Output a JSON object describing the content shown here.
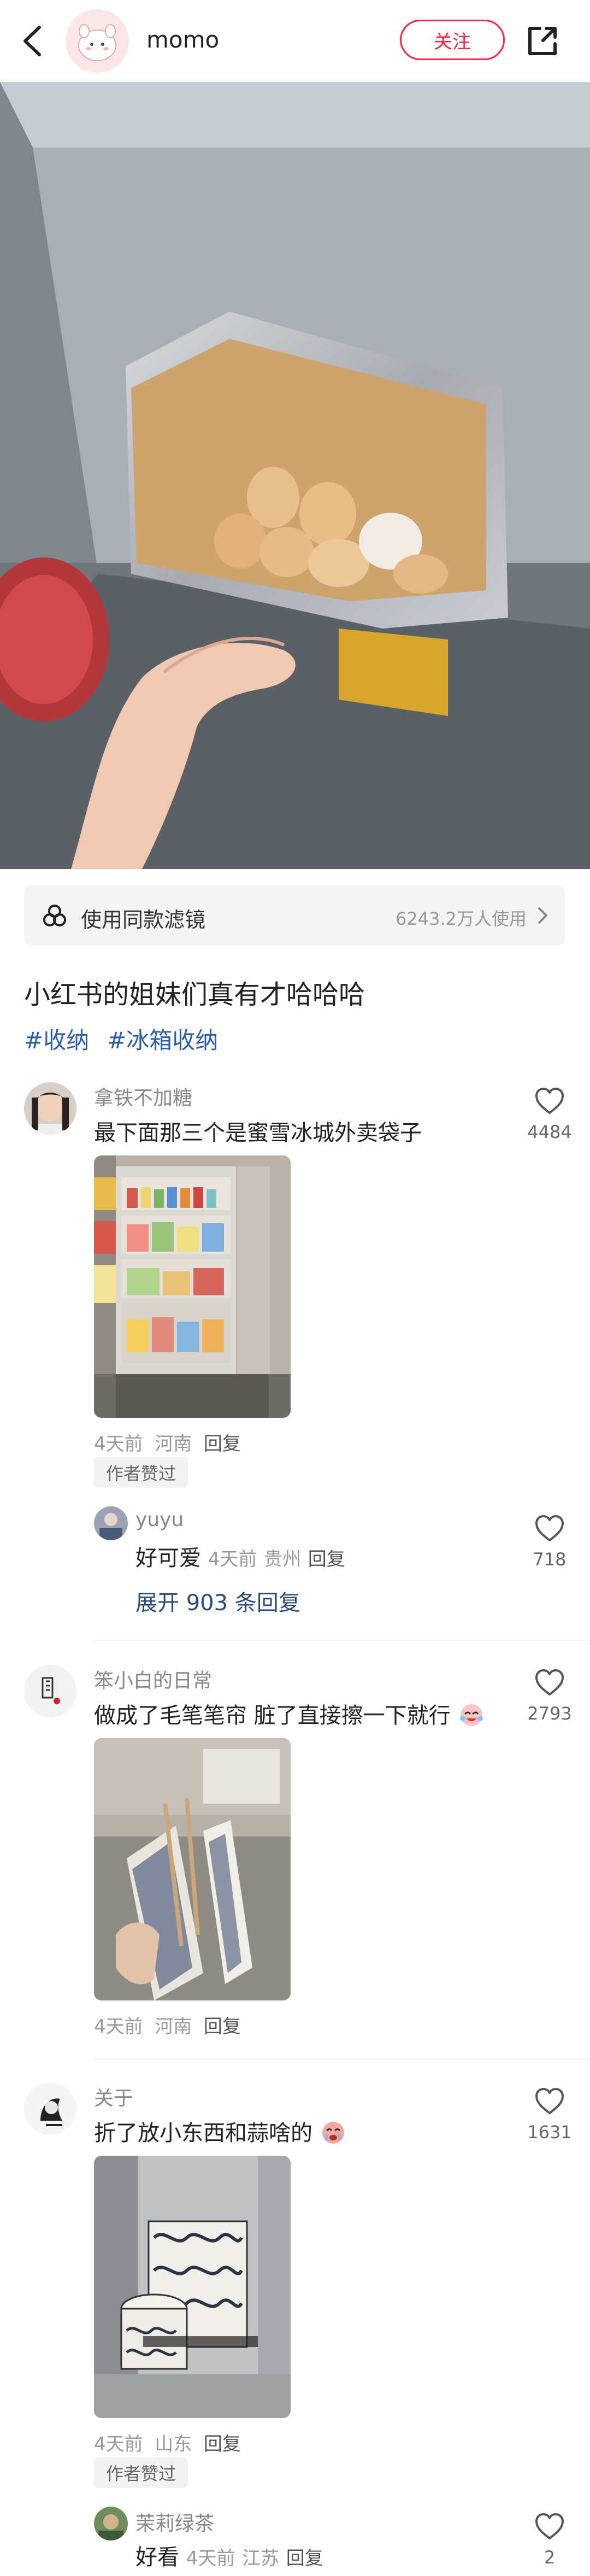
{
  "header": {
    "author": "momo",
    "follow_label": "关注"
  },
  "filter": {
    "label": "使用同款滤镜",
    "count": "6243.2万人使用"
  },
  "post": {
    "title": "小红书的姐妹们真有才哈哈哈",
    "tags": [
      "#收纳",
      "#冰箱收纳"
    ]
  },
  "comments": [
    {
      "name": "拿铁不加糖",
      "text": "最下面那三个是蜜雪冰城外卖袋子",
      "time": "4天前",
      "location": "河南",
      "reply_label": "回复",
      "likes": "4484",
      "badge": "作者赞过",
      "replies": [
        {
          "name": "yuyu",
          "text": "好可爱",
          "time": "4天前",
          "location": "贵州",
          "reply_label": "回复",
          "likes": "718"
        }
      ],
      "expand_label": "展开 903 条回复"
    },
    {
      "name": "笨小白的日常",
      "text": "做成了毛笔笔帘 脏了直接擦一下就行",
      "time": "4天前",
      "location": "河南",
      "reply_label": "回复",
      "likes": "2793"
    },
    {
      "name": "关于",
      "text": "折了放小东西和蒜啥的",
      "time": "4天前",
      "location": "山东",
      "reply_label": "回复",
      "likes": "1631",
      "badge": "作者赞过",
      "replies": [
        {
          "name": "茉莉绿茶",
          "text": "好看",
          "time": "4天前",
          "location": "江苏",
          "reply_label": "回复",
          "likes": "2"
        }
      ]
    }
  ],
  "colors": {
    "accent": "#ff2442",
    "tag": "#2b5ea8",
    "link": "#2b4a7c"
  }
}
